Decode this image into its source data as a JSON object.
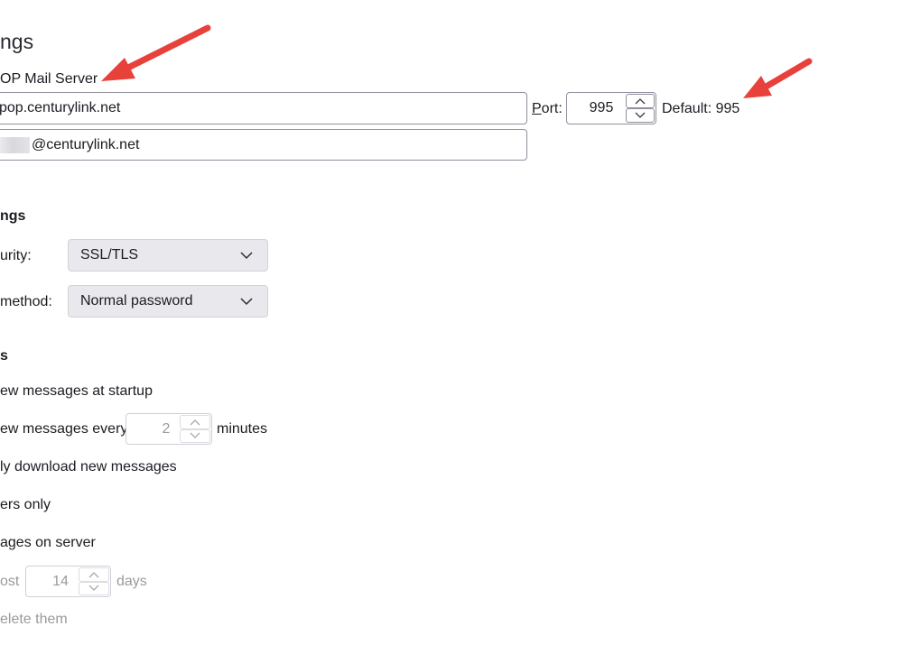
{
  "server_settings": {
    "title": "ngs",
    "server_type_label": "OP Mail Server",
    "server_name_value": "pop.centurylink.net",
    "port_label_accesskey": "P",
    "port_label_rest": "ort:",
    "port_value": "995",
    "default_port_text": "Default: 995",
    "username_value": "@centurylink.net"
  },
  "security_settings": {
    "heading": "ngs",
    "connection_security_label": "urity:",
    "connection_security_value": "SSL/TLS",
    "auth_method_label": "method:",
    "auth_method_value": "Normal password"
  },
  "server_options": {
    "heading": "s",
    "check_at_startup_label": "ew messages at startup",
    "check_every_label_prefix": "ew messages ever",
    "check_every_label_accesskey": "y",
    "check_every_value": "2",
    "minutes_label": "minutes",
    "auto_download_label": "ly download new messages",
    "headers_only_label": "ers only",
    "leave_on_server_label": "ages on server",
    "at_most_label": "ost",
    "at_most_value": "14",
    "days_label": "days",
    "delete_label": "elete them"
  },
  "annotation_colors": {
    "arrow": "#e8413c"
  },
  "icons": {
    "up": "chevron-up-icon",
    "down": "chevron-down-icon",
    "dropdown": "chevron-down-icon",
    "annotation": "red-arrow-icon"
  }
}
